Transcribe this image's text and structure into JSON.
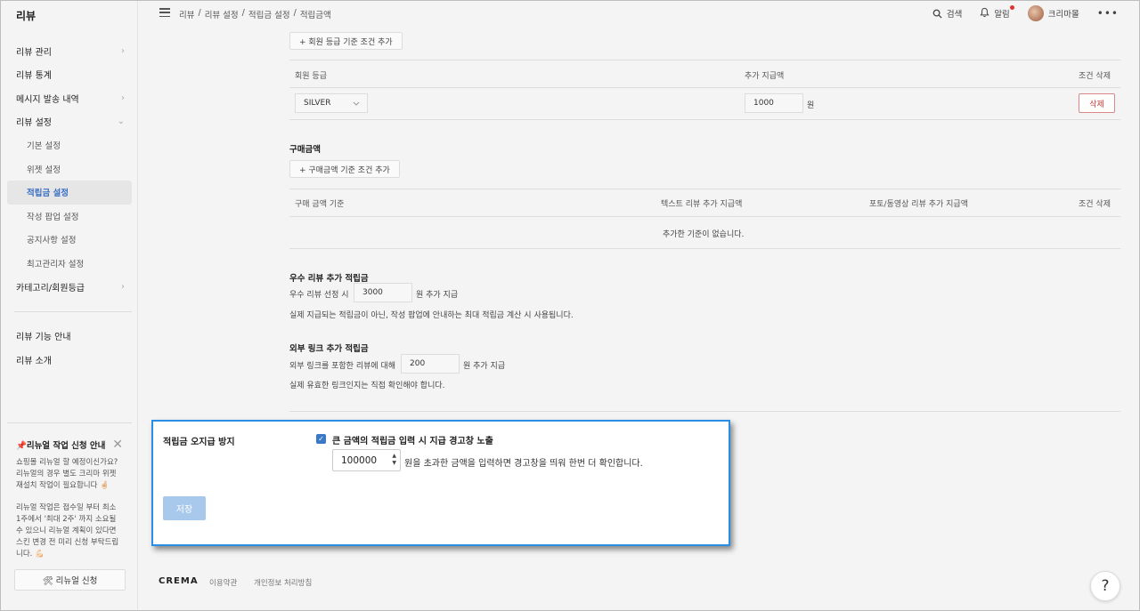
{
  "app": {
    "title": "리뷰"
  },
  "sidebar": {
    "items": [
      {
        "label": "리뷰 관리",
        "chevron": "›"
      },
      {
        "label": "리뷰 통계",
        "chevron": ""
      },
      {
        "label": "메시지 발송 내역",
        "chevron": "›"
      },
      {
        "label": "리뷰 설정",
        "chevron": "⌄"
      }
    ],
    "sub_items": [
      "기본 설정",
      "위젯 설정",
      "적립금 설정",
      "작성 팝업 설정",
      "공지사항 설정",
      "최고관리자 설정"
    ],
    "after_items": [
      {
        "label": "카테고리/회원등급",
        "chevron": "›"
      }
    ],
    "bottom_items": [
      "리뷰 기능 안내",
      "리뷰 소개"
    ],
    "notice": {
      "title": "📌리뉴얼 작업 신청 안내",
      "close": "✕",
      "body1": "쇼핑몰 리뉴얼 할 예정이신가요? 리뉴얼의 경우 별도 크리마 위젯 재설치 작업이 필요합니다 🤞🏻",
      "body2": "리뉴얼 작업은 접수일 부터 최소 1주에서 '최대 2주' 까지 소요될 수 있으니 리뉴얼 계획이 있다면 스킨 변경 전 미리 신청 부탁드립니다. 💪🏻"
    },
    "renewal_button": "🛠 리뉴얼 신청"
  },
  "header": {
    "breadcrumb": [
      "리뷰",
      "/",
      "리뷰 설정",
      "/",
      "적립금 설정",
      "/",
      "적립금액"
    ],
    "search": "검색",
    "alarm": "알림",
    "user": "크리마몰",
    "more": "•••"
  },
  "grade_section": {
    "add_button": "+ 회원 등급 기준 조건 추가",
    "columns": [
      "회원 등급",
      "추가 지급액",
      "조건 삭제"
    ],
    "row": {
      "grade": "SILVER",
      "amount": "1000",
      "unit": "원",
      "delete": "삭제"
    }
  },
  "purchase_section": {
    "title": "구매금액",
    "add_button": "+ 구매금액 기준 조건 추가",
    "columns": [
      "구매 금액 기준",
      "텍스트 리뷰 추가 지급액",
      "포토/동영상 리뷰 추가 지급액",
      "조건 삭제"
    ],
    "empty": "추가한 기준이 없습니다."
  },
  "best_review": {
    "title": "우수 리뷰 추가 적립금",
    "prefix": "우수 리뷰 선정 시",
    "value": "3000",
    "suffix": "원 추가 지급",
    "note": "실제 지급되는 적립금이 아닌, 작성 팝업에 안내하는 최대 적립금 계산 시 사용됩니다."
  },
  "external_link": {
    "title": "외부 링크 추가 적립금",
    "prefix": "외부 링크를 포함한 리뷰에 대해",
    "value": "200",
    "suffix": "원 추가 지급",
    "note": "실제 유효한 링크인지는 직접 확인해야 합니다."
  },
  "overpay": {
    "title": "적립금 오지급 방지",
    "checkbox_label": "큰 금액의 적립금 입력 시 지급 경고창 노출",
    "checked": true,
    "threshold": "100000",
    "hint": "원을 초과한 금액을 입력하면 경고창을 띄워 한번 더 확인합니다.",
    "save": "저장"
  },
  "footer": {
    "logo": "CREMA",
    "links": [
      "이용약관",
      "개인정보 처리방침"
    ]
  },
  "help": "?",
  "colors": {
    "accent": "#3a6fc4",
    "highlight_border": "#2a8ee6",
    "danger": "#c33333"
  }
}
